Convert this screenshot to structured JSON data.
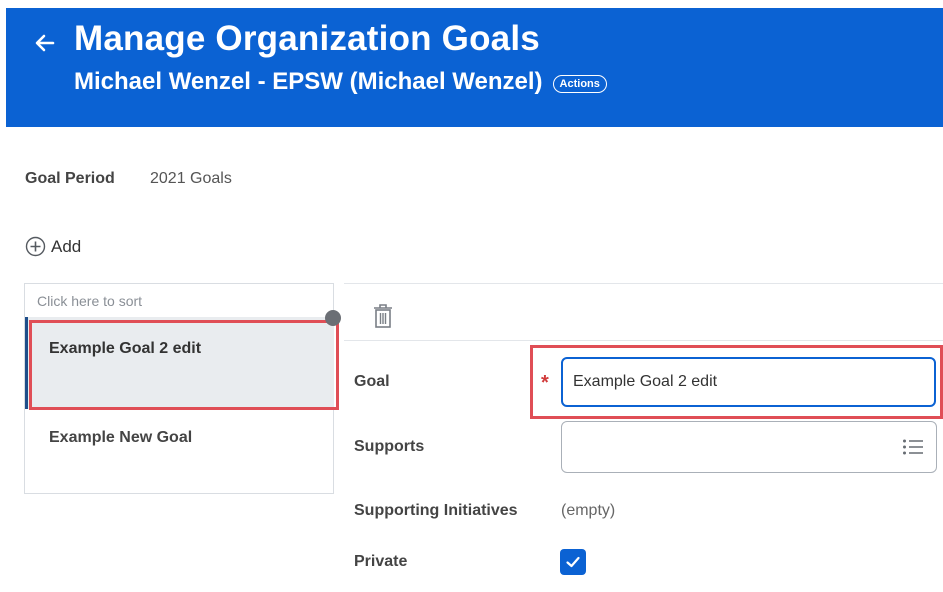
{
  "header": {
    "title": "Manage Organization Goals",
    "subtitle": "Michael Wenzel - EPSW (Michael Wenzel)",
    "actions_label": "Actions",
    "background_color": "#0b62d3"
  },
  "goal_period": {
    "label": "Goal Period",
    "value": "2021 Goals"
  },
  "add_button": {
    "label": "Add",
    "icon": "plus-circle-icon"
  },
  "goal_list": {
    "sort_hint": "Click here to sort",
    "items": [
      {
        "label": "Example Goal 2 edit",
        "selected": true
      },
      {
        "label": "Example New Goal",
        "selected": false
      }
    ]
  },
  "detail": {
    "delete_icon": "trash-icon",
    "goal": {
      "label": "Goal",
      "value": "Example Goal 2 edit",
      "required": true
    },
    "supports": {
      "label": "Supports",
      "value": "",
      "icon": "list-icon"
    },
    "supporting_initiatives": {
      "label": "Supporting Initiatives",
      "value": "(empty)"
    },
    "private": {
      "label": "Private",
      "checked": true
    }
  },
  "colors": {
    "accent": "#0b62d3",
    "highlight": "#e04e56",
    "required": "#d13b3b"
  }
}
